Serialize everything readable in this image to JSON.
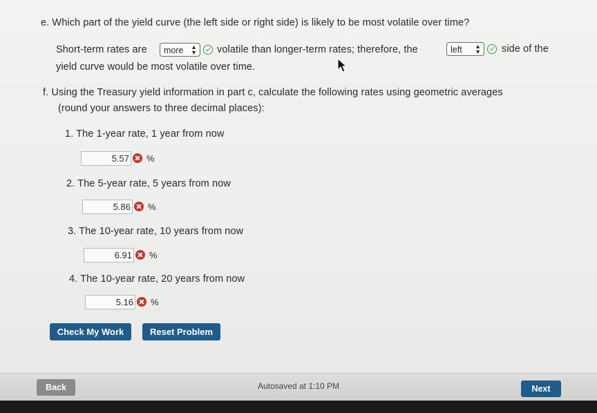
{
  "part_e": {
    "question": "e. Which part of the yield curve (the left side or right side) is likely to be most volatile over time?",
    "line1_a": "Short-term rates are",
    "select1_value": "more",
    "line1_b": "volatile than longer-term rates; therefore, the",
    "select2_value": "left",
    "line1_c": "side of the",
    "line2": "yield curve would be most volatile over time."
  },
  "part_f": {
    "question_line1": "f. Using the Treasury yield information in part c, calculate the following rates using geometric averages",
    "question_line2": "(round your answers to three decimal places):",
    "items": [
      {
        "label": "1.  The 1-year rate, 1 year from now",
        "value": "5.57",
        "unit": "%"
      },
      {
        "label": "2.  The 5-year rate, 5 years from now",
        "value": "5.86",
        "unit": "%"
      },
      {
        "label": "3.  The 10-year rate, 10 years from now",
        "value": "6.91",
        "unit": "%"
      },
      {
        "label": "4.  The 10-year rate, 20 years from now",
        "value": "5.16",
        "unit": "%"
      }
    ]
  },
  "buttons": {
    "check": "Check My Work",
    "reset": "Reset Problem"
  },
  "footer": {
    "back": "Back",
    "autosave": "Autosaved at 1:10 PM",
    "next": "Next"
  },
  "icons": {
    "correct": "check-circle-icon",
    "incorrect": "x-circle-icon",
    "cursor": "mouse-pointer-icon"
  },
  "colors": {
    "primary_button": "#1f5c8c",
    "correct": "#3a9a3a",
    "incorrect": "#c0392b"
  }
}
